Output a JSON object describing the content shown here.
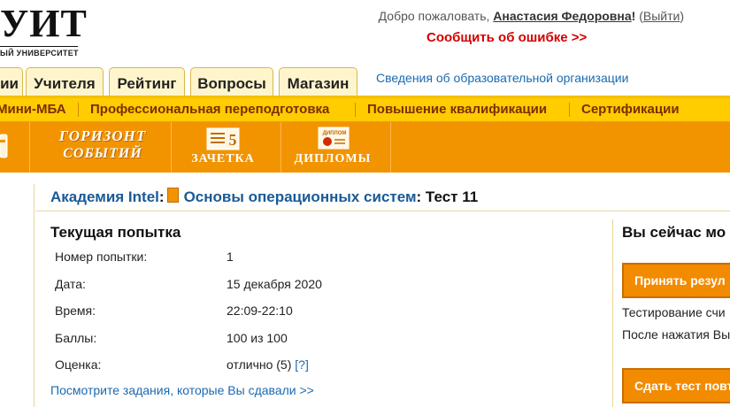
{
  "header": {
    "logo_big": "УИТ",
    "logo_small": "ЫЙ УНИВЕРСИТЕТ",
    "welcome_prefix": "Добро пожаловать, ",
    "user_name": "Анастасия Федоровна",
    "excl": "!",
    "paren_open": " (",
    "logout_label": "Выйти",
    "paren_close": ")",
    "report_error": "Сообщить об ошибке >>"
  },
  "tabs": [
    {
      "label": "ии"
    },
    {
      "label": "Учителя"
    },
    {
      "label": "Рейтинг"
    },
    {
      "label": "Вопросы"
    },
    {
      "label": "Магазин"
    }
  ],
  "org_info_link": "Сведения об образовательной организации",
  "yellow_nav": [
    {
      "label": "Мини-МБА"
    },
    {
      "label": "Профессиональная переподготовка"
    },
    {
      "label": "Повышение квалификации"
    },
    {
      "label": "Сертификации"
    }
  ],
  "banner": {
    "gorizont_l1": "ГОРИЗОНТ",
    "gorizont_l2": "СОБЫТИЙ",
    "zachetka": "ЗАЧЕТКА",
    "zachetka_num": "5",
    "diplomy": "ДИПЛОМЫ",
    "diplom_small": "ДИПЛОМ"
  },
  "breadcrumb": {
    "academy": "Академия Intel",
    "colon1": ":",
    "course": "Основы операционных систем",
    "test": ": Тест 11"
  },
  "attempt": {
    "title": "Текущая попытка",
    "rows": [
      {
        "label": "Номер попытки:",
        "value": "1"
      },
      {
        "label": "Дата:",
        "value": "15 декабря 2020"
      },
      {
        "label": "Время:",
        "value": "22:09-22:10"
      },
      {
        "label": "Баллы:",
        "value": "100 из 100"
      },
      {
        "label": "Оценка:",
        "value": "отлично (5)"
      }
    ],
    "help": "[?]",
    "see_tasks": "Посмотрите задания, которые Вы сдавали >>"
  },
  "right_panel": {
    "title": "Вы сейчас мо",
    "accept_button": "Принять резул",
    "text1": "Тестирование счи",
    "text2": "После нажатия Вы",
    "retake_button": "Сдать тест повт"
  },
  "colors": {
    "accent_orange": "#f29400",
    "nav_yellow": "#ffcc00",
    "link_blue": "#1a6ab0",
    "error_red": "#d40000"
  }
}
